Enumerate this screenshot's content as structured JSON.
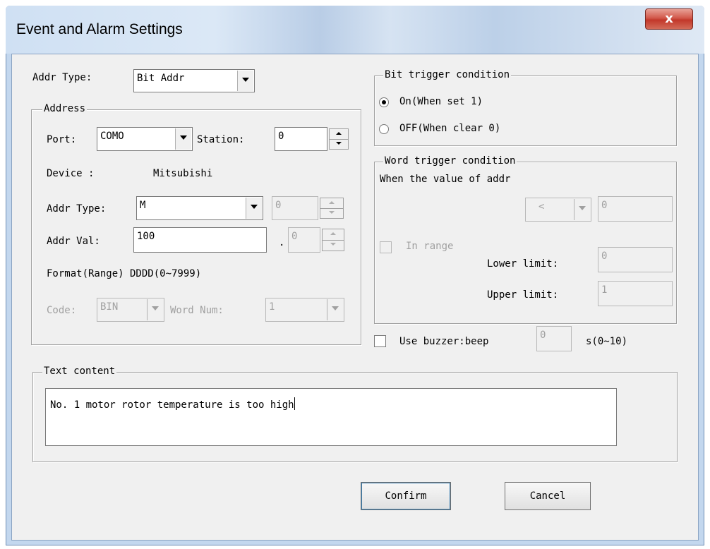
{
  "window": {
    "title": "Event and Alarm Settings",
    "close_glyph": "x"
  },
  "addr_type": {
    "label": "Addr Type:",
    "value": "Bit Addr"
  },
  "address": {
    "group_label": "Address",
    "port_label": "Port:",
    "port_value": "COMO",
    "station_label": "Station:",
    "station_value": "0",
    "device_label": "Device :",
    "device_value": "Mitsubishi",
    "addr_type_label": "Addr Type:",
    "addr_type_value": "M",
    "addr_type_spin_value": "0",
    "addr_val_label": "Addr Val:",
    "addr_val_value": "100",
    "addr_val_sep": ".",
    "addr_val_sub_value": "0",
    "format_text": "Format(Range) DDDD(0~7999)",
    "code_label": "Code:",
    "code_value": "BIN",
    "word_num_label": "Word Num:",
    "word_num_value": "1"
  },
  "bit_trigger": {
    "group_label": "Bit trigger condition",
    "on_label": "On(When set 1)",
    "off_label": "OFF(When clear 0)",
    "selected": "on"
  },
  "word_trigger": {
    "group_label": "Word trigger condition",
    "desc": "When the value of addr",
    "operator_value": "<",
    "compare_value": "0",
    "in_range_label": "In range",
    "lower_label": "Lower limit:",
    "lower_value": "0",
    "upper_label": "Upper limit:",
    "upper_value": "1"
  },
  "buzzer": {
    "label": "Use buzzer:beep",
    "value": "0",
    "unit": "s(0~10)",
    "checked": false
  },
  "text_content": {
    "group_label": "Text content",
    "value": "No. 1 motor rotor temperature is too high"
  },
  "buttons": {
    "confirm": "Confirm",
    "cancel": "Cancel"
  }
}
